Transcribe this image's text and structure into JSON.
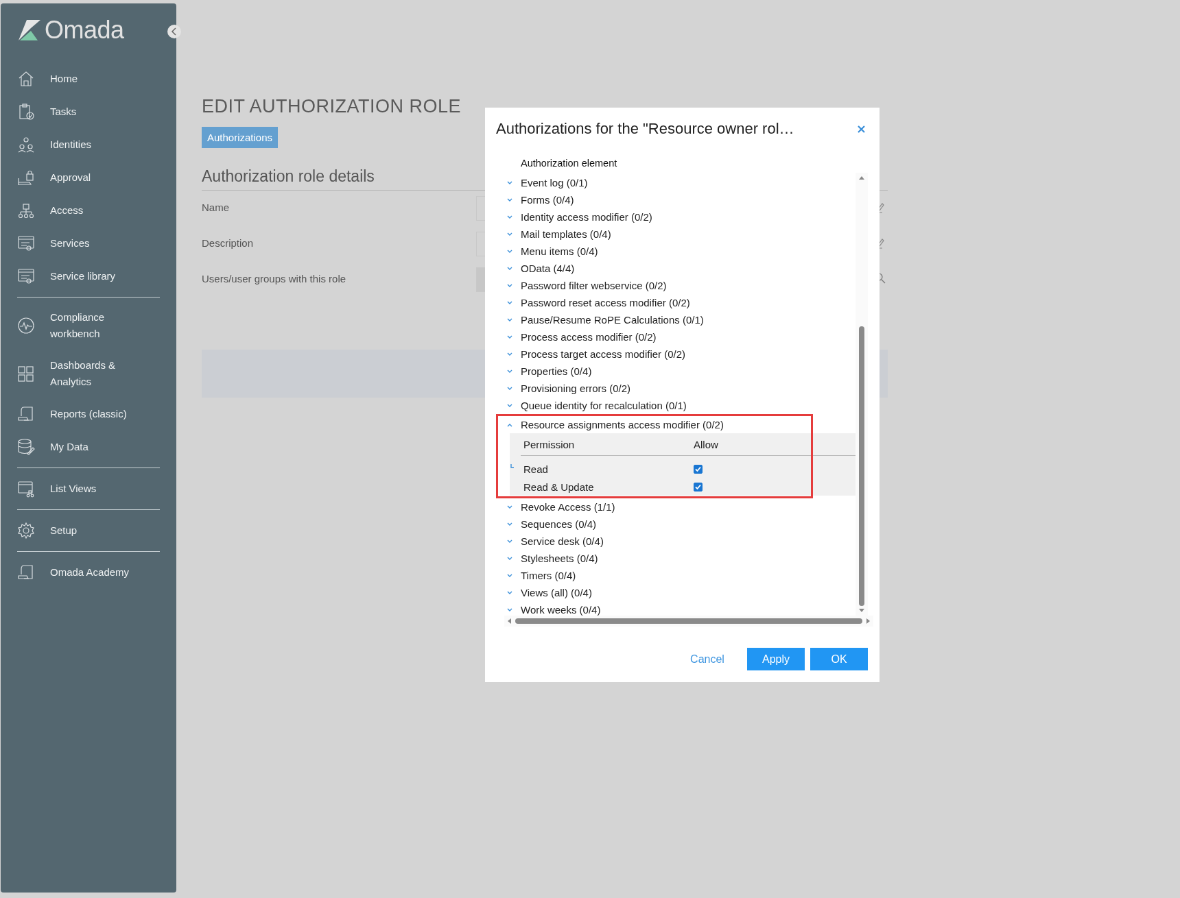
{
  "sidebar": {
    "logo": "Omada",
    "sections": [
      [
        {
          "label": "Home"
        },
        {
          "label": "Tasks"
        },
        {
          "label": "Identities"
        },
        {
          "label": "Approval"
        },
        {
          "label": "Access"
        },
        {
          "label": "Services"
        },
        {
          "label": "Service library"
        }
      ],
      [
        {
          "label": "Compliance workbench"
        },
        {
          "label": "Dashboards & Analytics"
        },
        {
          "label": "Reports (classic)"
        },
        {
          "label": "My Data"
        }
      ],
      [
        {
          "label": "List Views"
        }
      ],
      [
        {
          "label": "Setup"
        }
      ],
      [
        {
          "label": "Omada Academy"
        }
      ]
    ]
  },
  "page": {
    "title": "EDIT AUTHORIZATION ROLE",
    "tabs": [
      {
        "label": "Authorizations",
        "selected": true
      }
    ],
    "section_title": "Authorization role details",
    "fields": [
      {
        "label": "Name"
      },
      {
        "label": "Description"
      },
      {
        "label": "Users/user groups with this role"
      }
    ]
  },
  "dialog": {
    "title": "Authorizations for the \"Resource owner rol…",
    "column": "Authorization element",
    "items": [
      {
        "label": "Event log (0/1)",
        "expanded": false
      },
      {
        "label": "Forms (0/4)",
        "expanded": false
      },
      {
        "label": "Identity access modifier (0/2)",
        "expanded": false
      },
      {
        "label": "Mail templates (0/4)",
        "expanded": false
      },
      {
        "label": "Menu items (0/4)",
        "expanded": false
      },
      {
        "label": "OData (4/4)",
        "expanded": false
      },
      {
        "label": "Password filter webservice (0/2)",
        "expanded": false
      },
      {
        "label": "Password reset access modifier (0/2)",
        "expanded": false
      },
      {
        "label": "Pause/Resume RoPE Calculations (0/1)",
        "expanded": false
      },
      {
        "label": "Process access modifier (0/2)",
        "expanded": false
      },
      {
        "label": "Process target access modifier (0/2)",
        "expanded": false
      },
      {
        "label": "Properties (0/4)",
        "expanded": false
      },
      {
        "label": "Provisioning errors (0/2)",
        "expanded": false
      },
      {
        "label": "Queue identity for recalculation (0/1)",
        "expanded": false
      },
      {
        "label": "Resource assignments access modifier (0/2)",
        "expanded": true,
        "highlighted": true,
        "columns": [
          "Permission",
          "Allow"
        ],
        "permissions": [
          {
            "label": "Read",
            "checked": true
          },
          {
            "label": "Read & Update",
            "checked": true
          }
        ]
      },
      {
        "label": "Revoke Access (1/1)",
        "expanded": false
      },
      {
        "label": "Sequences (0/4)",
        "expanded": false
      },
      {
        "label": "Service desk (0/4)",
        "expanded": false
      },
      {
        "label": "Stylesheets (0/4)",
        "expanded": false
      },
      {
        "label": "Timers (0/4)",
        "expanded": false
      },
      {
        "label": "Views (all) (0/4)",
        "expanded": false
      },
      {
        "label": "Work weeks (0/4)",
        "expanded": false
      }
    ],
    "buttons": [
      {
        "label": "Cancel",
        "kind": "link"
      },
      {
        "label": "Apply",
        "kind": "primary"
      },
      {
        "label": "OK",
        "kind": "primary"
      }
    ]
  }
}
